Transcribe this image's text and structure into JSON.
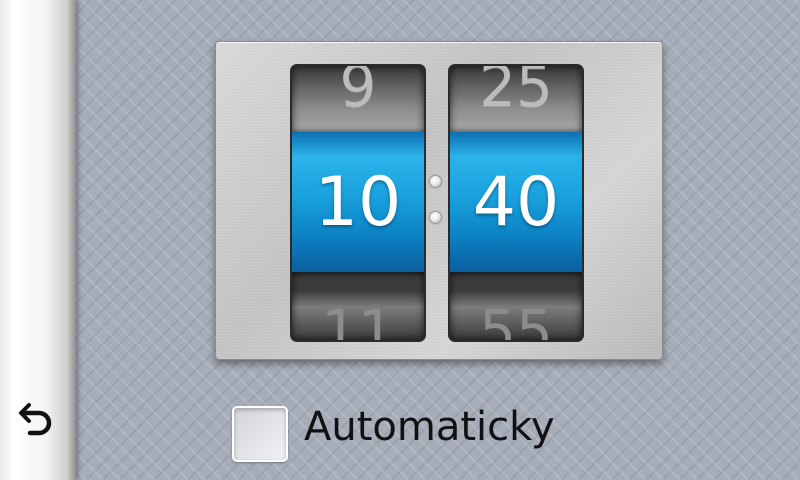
{
  "sidebar": {
    "back_icon": "back-arrow-icon"
  },
  "time_picker": {
    "hours": {
      "previous": "9",
      "current": "10",
      "next": "11"
    },
    "minutes": {
      "previous": "25",
      "current": "40",
      "next": "55"
    },
    "accent_color": "#19a2de"
  },
  "auto_option": {
    "label": "Automaticky",
    "checked": false
  }
}
